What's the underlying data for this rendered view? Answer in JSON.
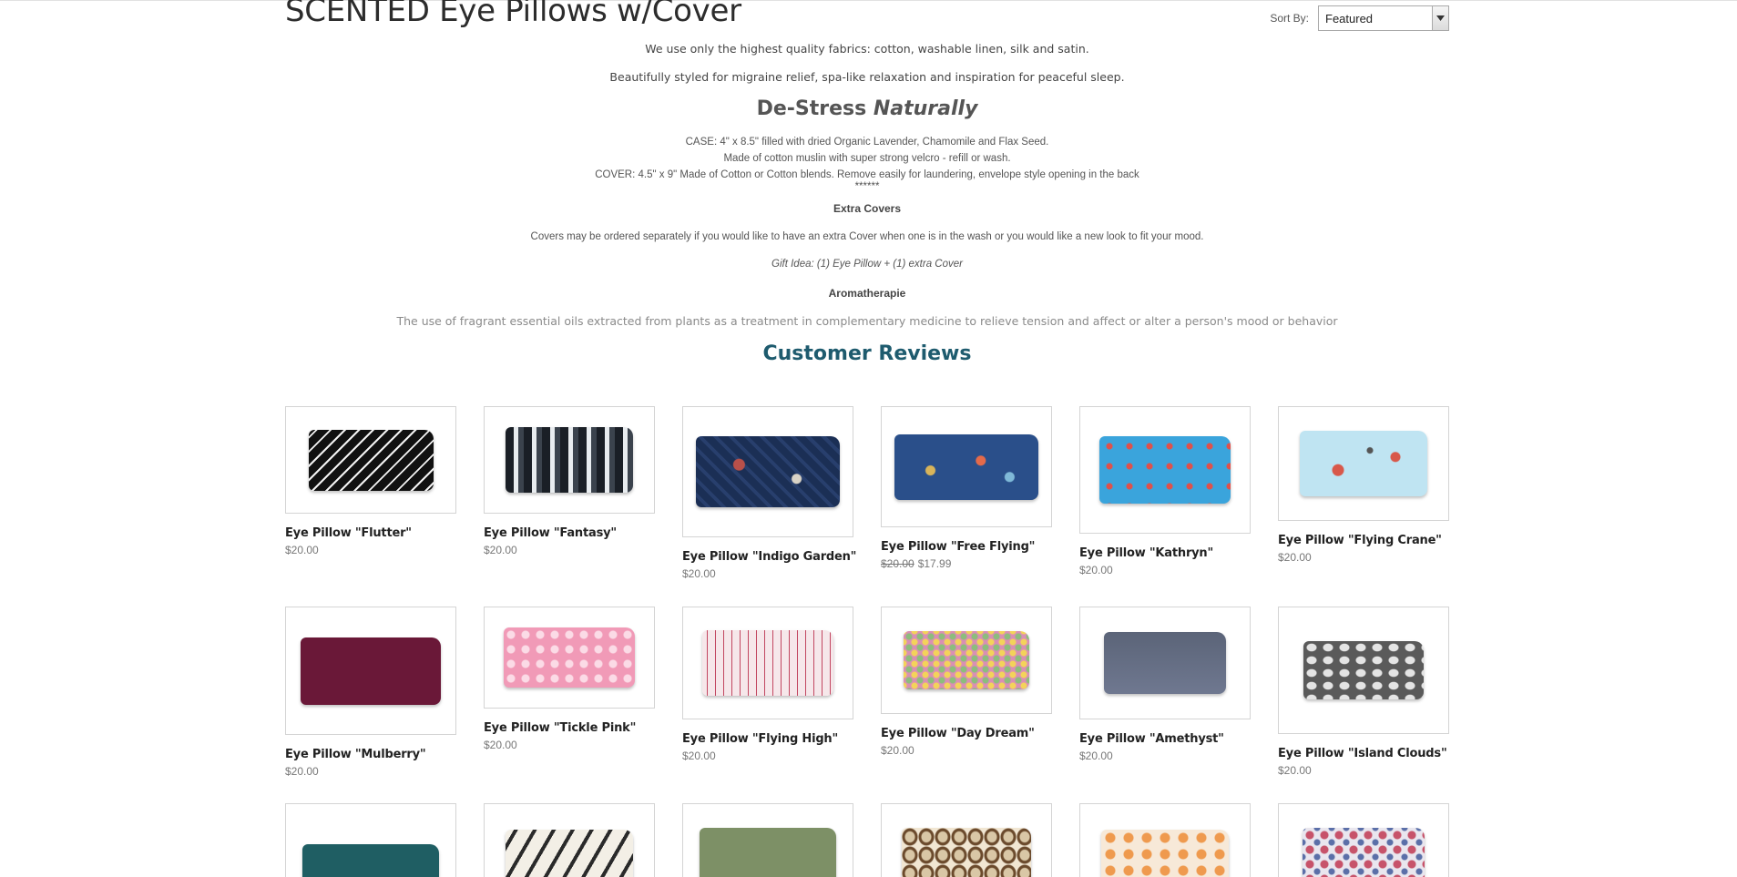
{
  "page": {
    "title": "SCENTED Eye Pillows w/Cover"
  },
  "sort": {
    "label": "Sort By:",
    "selected": "Featured"
  },
  "description": {
    "line1": "We use only the highest quality fabrics:  cotton, washable linen, silk and satin.",
    "line2": "Beautifully styled for migraine relief, spa-like relaxation and inspiration for peaceful sleep.",
    "destress_a": "De-Stress ",
    "destress_b": "Naturally",
    "case_line": "CASE: 4\" x 8.5\"  filled with dried Organic Lavender, Chamomile and Flax Seed.",
    "muslin_line": "Made of cotton muslin with super strong velcro - refill or wash.",
    "cover_line": "COVER: 4.5\" x 9\" Made of Cotton or Cotton blends.  Remove easily for laundering, envelope style opening in the back",
    "stars": "******",
    "extra_heading": "Extra Covers",
    "extra_text": "Covers may be ordered separately if you would like to have an extra Cover when one is in the wash or you would like a new look to fit your mood.",
    "gift_idea": "Gift Idea: (1) Eye Pillow + (1) extra Cover",
    "aroma_heading": "Aromatherapie",
    "aroma_text": "The use of fragrant essential oils extracted from plants as a treatment in complementary medicine to relieve tension and affect or alter a person's mood or behavior",
    "reviews_heading": "Customer Reviews"
  },
  "products": [
    {
      "name": "Eye Pillow \"Flutter\"",
      "price": "$20.00",
      "colors": [
        "#111111",
        "#f2f2f2"
      ]
    },
    {
      "name": "Eye Pillow \"Fantasy\"",
      "price": "$20.00",
      "colors": [
        "#1a1f26",
        "#e8ecef"
      ]
    },
    {
      "name": "Eye Pillow \"Indigo Garden\"",
      "price": "$20.00",
      "colors": [
        "#1b2f55",
        "#b8504a"
      ]
    },
    {
      "name": "Eye Pillow \"Free Flying\"",
      "price_old": "$20.00",
      "price": "$17.99",
      "colors": [
        "#2a4f8a",
        "#d8b45a"
      ]
    },
    {
      "name": "Eye Pillow \"Kathryn\"",
      "price": "$20.00",
      "colors": [
        "#3aa4dc",
        "#e0504a"
      ]
    },
    {
      "name": "Eye Pillow \"Flying Crane\"",
      "price": "$20.00",
      "colors": [
        "#bfe4f2",
        "#d8584a"
      ]
    },
    {
      "name": "Eye Pillow \"Mulberry\"",
      "price": "$20.00",
      "colors": [
        "#6a1838",
        "#7d2346"
      ]
    },
    {
      "name": "Eye Pillow \"Tickle Pink\"",
      "price": "$20.00",
      "colors": [
        "#f19ab7",
        "#fbdbe6"
      ]
    },
    {
      "name": "Eye Pillow \"Flying High\"",
      "price": "$20.00",
      "colors": [
        "#f6e7ea",
        "#c24660"
      ]
    },
    {
      "name": "Eye Pillow \"Day Dream\"",
      "price": "$20.00",
      "colors": [
        "#d98fb4",
        "#8cbd7c"
      ]
    },
    {
      "name": "Eye Pillow \"Amethyst\"",
      "price": "$20.00",
      "colors": [
        "#5b6478",
        "#6f7890"
      ]
    },
    {
      "name": "Eye Pillow \"Island Clouds\"",
      "price": "$20.00",
      "colors": [
        "#5a5a5a",
        "#e4e4e4"
      ]
    },
    {
      "colors": [
        "#1f5e63",
        "#2b6f75"
      ]
    },
    {
      "colors": [
        "#f3efe6",
        "#2a2a2a"
      ]
    },
    {
      "colors": [
        "#7d9066",
        "#8d9f75"
      ]
    },
    {
      "colors": [
        "#6b4a2c",
        "#d9c7a6"
      ]
    },
    {
      "colors": [
        "#f7e9d8",
        "#ef9a4e"
      ]
    },
    {
      "colors": [
        "#e9e6ee",
        "#c7536a"
      ]
    }
  ]
}
